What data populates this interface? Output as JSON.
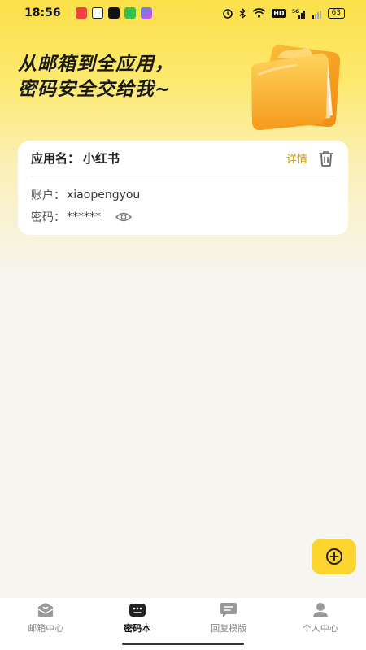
{
  "status": {
    "time": "18:56",
    "battery": "63",
    "network": "5G",
    "hd": "HD"
  },
  "hero": {
    "line1": "从邮箱到全应用，",
    "line2": "密码安全交给我~"
  },
  "card": {
    "app_label": "应用名：",
    "app_value": "小红书",
    "detail_label": "详情",
    "account_label": "账户：",
    "account_value": "xiaopengyou",
    "password_label": "密码：",
    "password_value": "******"
  },
  "tabs": [
    {
      "label": "邮箱中心",
      "icon": "mailbox-icon",
      "active": false
    },
    {
      "label": "密码本",
      "icon": "password-book-icon",
      "active": true
    },
    {
      "label": "回复模版",
      "icon": "message-template-icon",
      "active": false
    },
    {
      "label": "个人中心",
      "icon": "user-icon",
      "active": false
    }
  ],
  "colors": {
    "accent": "#fdd52e",
    "link": "#d79a00",
    "background": "#f7f5ef"
  }
}
